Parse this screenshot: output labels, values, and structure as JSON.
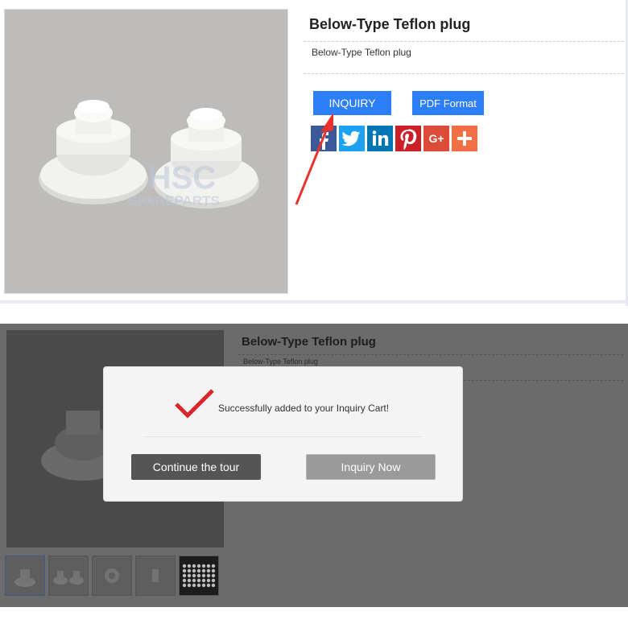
{
  "product": {
    "title": "Below-Type Teflon plug",
    "subtitle": "Below-Type Teflon plug"
  },
  "actions": {
    "inquiry_label": "INQUIRY",
    "pdf_label": "PDF Format"
  },
  "watermark": {
    "line1": "HSC",
    "line2": "SPAREPARTS"
  },
  "social": [
    {
      "name": "facebook-icon",
      "glyph": "f",
      "color": "#3b5998"
    },
    {
      "name": "twitter-icon",
      "glyph": "t",
      "color": "#1da1f2"
    },
    {
      "name": "linkedin-icon",
      "glyph": "in",
      "color": "#0077b5"
    },
    {
      "name": "pinterest-icon",
      "glyph": "P",
      "color": "#cb2027"
    },
    {
      "name": "google-plus-icon",
      "glyph": "G+",
      "color": "#dd4b39"
    },
    {
      "name": "share-more-icon",
      "glyph": "+",
      "color": "#f36f45"
    }
  ],
  "modal": {
    "message": "Successfully added to your Inquiry Cart!",
    "continue_label": "Continue the tour",
    "inquiry_now_label": "Inquiry Now"
  },
  "thumbnails": [
    {
      "name": "thumb-1",
      "active": true
    },
    {
      "name": "thumb-2",
      "active": false
    },
    {
      "name": "thumb-3",
      "active": false
    },
    {
      "name": "thumb-4",
      "active": false
    },
    {
      "name": "thumb-5",
      "active": false
    }
  ],
  "colors": {
    "accent": "#2d7ff9",
    "check": "#d8262f",
    "continue_btn": "#555555",
    "inquiry_now_btn": "#9a9a9a"
  }
}
